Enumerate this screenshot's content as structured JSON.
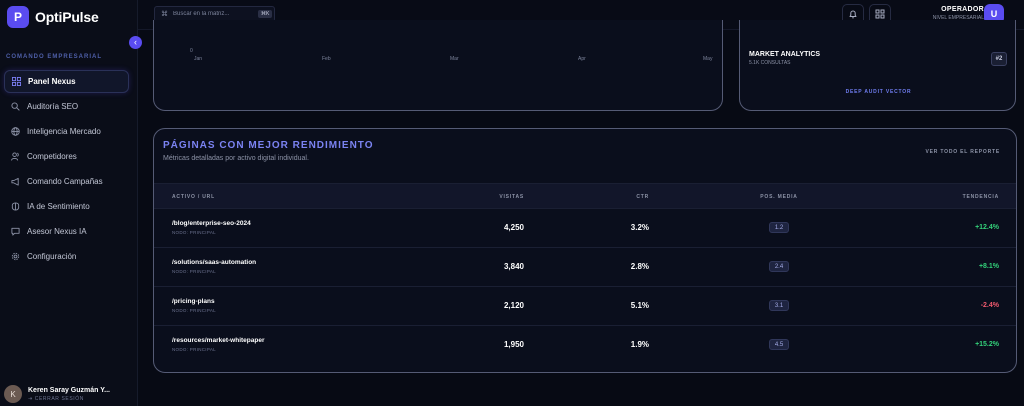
{
  "app": {
    "logo_letter": "P",
    "name": "OptiPulse"
  },
  "sidebar": {
    "section_label": "COMANDO EMPRESARIAL",
    "items": [
      {
        "label": "Panel Nexus",
        "icon": "grid-icon",
        "active": true
      },
      {
        "label": "Auditoría SEO",
        "icon": "search-icon"
      },
      {
        "label": "Inteligencia Mercado",
        "icon": "globe-icon"
      },
      {
        "label": "Competidores",
        "icon": "users-icon"
      },
      {
        "label": "Comando Campañas",
        "icon": "megaphone-icon"
      },
      {
        "label": "IA de Sentimiento",
        "icon": "brain-icon"
      },
      {
        "label": "Asesor Nexus IA",
        "icon": "chat-icon"
      },
      {
        "label": "Configuración",
        "icon": "gear-icon"
      }
    ],
    "user": {
      "initial": "K",
      "name": "Keren Saray Guzmán Y...",
      "logout": "CERRAR SESIÓN"
    }
  },
  "topbar": {
    "search_placeholder": "Buscar en la matriz...",
    "search_shortcut": "⌘K",
    "operator_role": "OPERADOR",
    "operator_level": "NIVEL EMPRESARIAL",
    "operator_initial": "U"
  },
  "chart": {
    "zero_label": "0",
    "months": [
      "Jan",
      "Feb",
      "Mar",
      "Apr",
      "May"
    ]
  },
  "market": {
    "title": "MARKET ANALYTICS",
    "subtitle": "5.1K CONSULTAS",
    "rank": "#2",
    "link": "DEEP AUDIT VECTOR"
  },
  "top_pages": {
    "title": "PÁGINAS CON MEJOR RENDIMIENTO",
    "subtitle": "Métricas detalladas por activo digital individual.",
    "view_all": "VER TODO EL REPORTE",
    "columns": [
      "ACTIVO / URL",
      "VISITAS",
      "CTR",
      "POS. MEDIA",
      "TENDENCIA"
    ],
    "rows": [
      {
        "url": "/blog/enterprise-seo-2024",
        "node": "NODO: PRINCIPAL",
        "visits": "4,250",
        "ctr": "3.2%",
        "pos": "1.2",
        "trend": "+12.4%"
      },
      {
        "url": "/solutions/saas-automation",
        "node": "NODO: PRINCIPAL",
        "visits": "3,840",
        "ctr": "2.8%",
        "pos": "2.4",
        "trend": "+8.1%"
      },
      {
        "url": "/pricing-plans",
        "node": "NODO: PRINCIPAL",
        "visits": "2,120",
        "ctr": "5.1%",
        "pos": "3.1",
        "trend": "-2.4%"
      },
      {
        "url": "/resources/market-whitepaper",
        "node": "NODO: PRINCIPAL",
        "visits": "1,950",
        "ctr": "1.9%",
        "pos": "4.5",
        "trend": "+15.2%"
      }
    ]
  },
  "colors": {
    "accent": "#5a4cf0",
    "positive": "#33d17a",
    "negative": "#f05a6e"
  }
}
